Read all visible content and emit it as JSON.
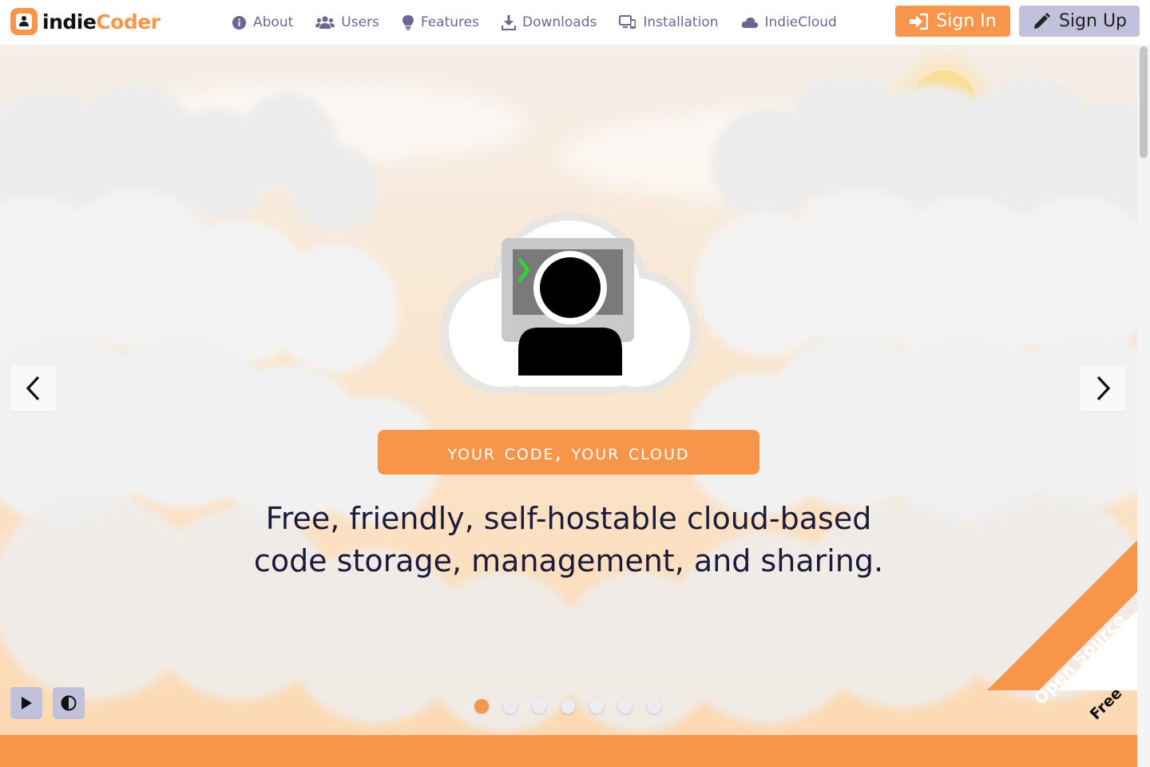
{
  "brand": {
    "name_part1": "indie",
    "name_part2": "Coder",
    "accent": "#f7954a"
  },
  "nav": {
    "items": [
      {
        "label": "About",
        "icon": "info-circle-icon"
      },
      {
        "label": "Users",
        "icon": "users-icon"
      },
      {
        "label": "Features",
        "icon": "lightbulb-icon"
      },
      {
        "label": "Downloads",
        "icon": "download-icon"
      },
      {
        "label": "Installation",
        "icon": "devices-icon"
      },
      {
        "label": "IndieCloud",
        "icon": "cloud-icon"
      }
    ],
    "signin_label": "Sign In",
    "signup_label": "Sign Up"
  },
  "hero": {
    "tagline": "Your code, your cloud",
    "headline_line1": "Free, friendly, self-hostable cloud-based",
    "headline_line2": "code storage, management, and sharing.",
    "slide_count": 7,
    "active_slide": 1
  },
  "ribbon": {
    "line1": "Open Source",
    "line2": "Free"
  },
  "colors": {
    "accent": "#f7954a",
    "button_secondary": "#c2c1db",
    "nav_text": "#6b6790",
    "headline": "#1d1b3a"
  }
}
